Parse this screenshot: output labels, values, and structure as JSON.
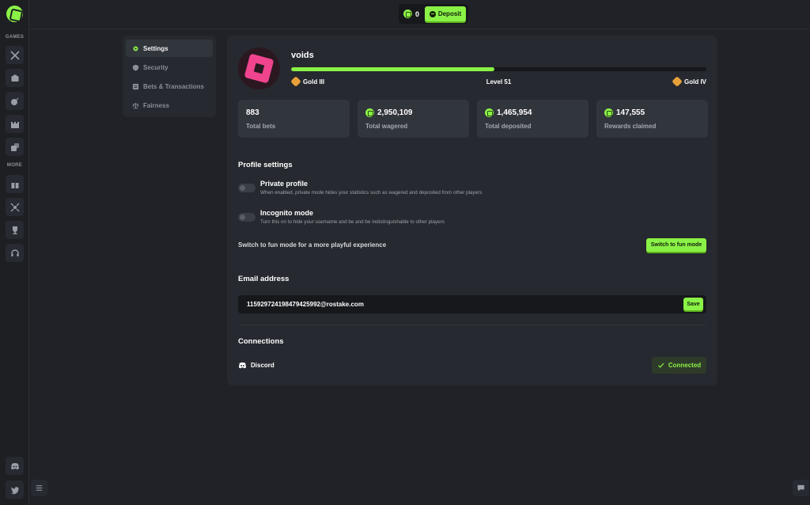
{
  "topbar": {
    "balance_value": "0",
    "deposit_label": "Deposit"
  },
  "rail": {
    "games_label": "GAMES",
    "more_label": "MORE",
    "game_icons": [
      "swords-icon",
      "case-icon",
      "bomb-icon",
      "castle-icon",
      "dice-icon"
    ],
    "more_icons": [
      "gift-icon",
      "affiliate-icon",
      "trophy-icon",
      "headset-icon"
    ],
    "bottom_icons": [
      "discord-icon",
      "twitter-icon"
    ]
  },
  "settings_nav": {
    "items": [
      {
        "label": "Settings",
        "icon": "gear-icon",
        "active": true
      },
      {
        "label": "Security",
        "icon": "shield-icon",
        "active": false
      },
      {
        "label": "Bets & Transactions",
        "icon": "list-icon",
        "active": false
      },
      {
        "label": "Fairness",
        "icon": "scale-icon",
        "active": false
      }
    ]
  },
  "profile": {
    "username": "voids",
    "progress_fraction": 0.49,
    "rank_current": "Gold III",
    "rank_next": "Gold IV",
    "level_label": "Level 51"
  },
  "stats": [
    {
      "value": "883",
      "label": "Total bets",
      "coin": false
    },
    {
      "value": "2,950,109",
      "label": "Total wagered",
      "coin": true
    },
    {
      "value": "1,465,954",
      "label": "Total deposited",
      "coin": true
    },
    {
      "value": "147,555",
      "label": "Rewards claimed",
      "coin": true
    }
  ],
  "profile_settings": {
    "title": "Profile settings",
    "private": {
      "title": "Private profile",
      "desc": "When enabled, private mode hides your statistics such as wagered and deposited from other players",
      "enabled": false
    },
    "incognito": {
      "title": "Incognito mode",
      "desc": "Turn this on to hide your username and be and be indistinguishable to other players",
      "enabled": false
    },
    "fun_text": "Switch to fun mode for a more playful experience",
    "fun_button": "Switch to fun mode"
  },
  "email": {
    "title": "Email address",
    "value": "115929724198479425992@rostake.com",
    "save_label": "Save"
  },
  "connections": {
    "title": "Connections",
    "service": "Discord",
    "status_label": "Connected"
  },
  "colors": {
    "accent": "#8af246",
    "background": "#202227",
    "card": "#26292f",
    "avatar_pink": "#f0448e"
  }
}
